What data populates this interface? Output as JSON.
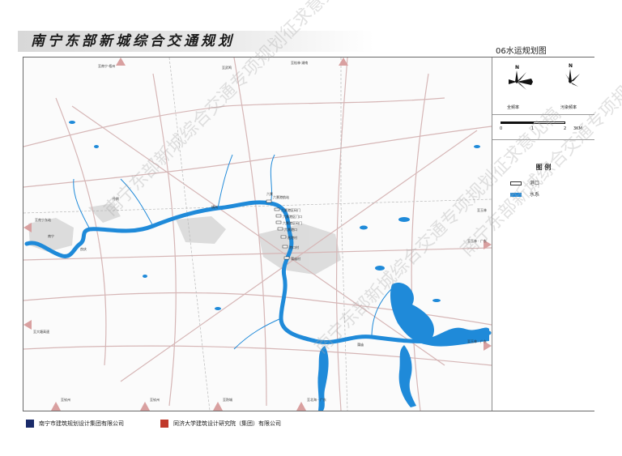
{
  "header": {
    "title": "南宁东部新城综合交通规划",
    "subtitle": "06水运规划图"
  },
  "compass": {
    "left_label": "全频率",
    "right_label": "污染频率"
  },
  "scale": {
    "ticks": [
      "0",
      "1",
      "2"
    ],
    "unit": "3KM"
  },
  "legend": {
    "title": "图 例",
    "items": [
      {
        "label": "港口",
        "color": "#ffffff"
      },
      {
        "label": "水系",
        "color": "#1e88d8"
      }
    ]
  },
  "map": {
    "colors": {
      "water": "#1f8ad9",
      "urban": "#d9d9d9",
      "road": "#c7a6a6",
      "arrow": "#d9a0a0"
    },
    "labels": {
      "top_left_road": "至南宁·梧州",
      "top_mid_road": "至武鸣",
      "top_right_road": "至桂林·湖南",
      "left_station": "至南宁东站",
      "left_lower": "至大塘高速",
      "right_1": "至玉林",
      "right_2": "至玉林 · 广东",
      "right_3": "至玉林 · 广东",
      "bottom_1": "至钦州",
      "bottom_2": "至钦州",
      "bottom_3": "至防城",
      "bottom_4": "至北海 · 广东",
      "port_1": "六景港航站",
      "port_2": "六景港区码门",
      "port_3": "六景港区门口",
      "port_4": "六景港区码门",
      "port_5": "六景港口",
      "port_6": "邕港村",
      "port_7": "港口村",
      "port_8": "蒲庙村",
      "port_9": "蒲庙",
      "town_1": "横州",
      "town_2": "伶俐",
      "town_3": "六景",
      "town_4": "南宁",
      "town_5": "良庆"
    }
  },
  "footer": {
    "org_left": "南宁市建筑规划设计集团有限公司",
    "org_right": "同济大学建筑设计研究院（集团）有限公司"
  },
  "watermark": {
    "text": "南宁东部新城综合交通专项规划征求意见稿"
  }
}
